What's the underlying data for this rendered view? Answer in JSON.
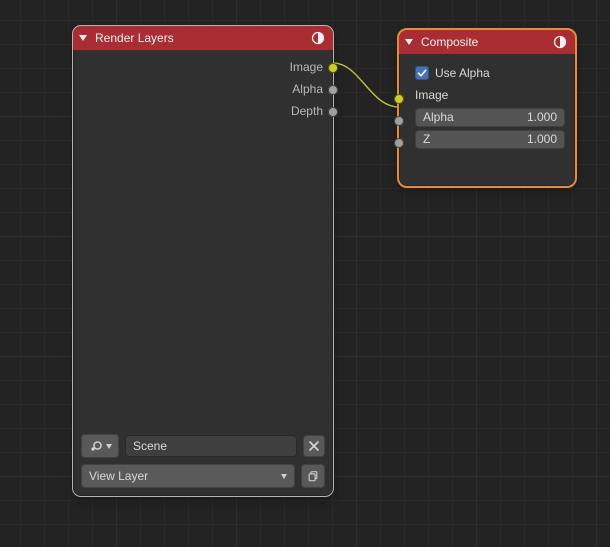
{
  "render_layers": {
    "title": "Render Layers",
    "outputs": {
      "image": "Image",
      "alpha": "Alpha",
      "depth": "Depth"
    },
    "scene_name": "Scene",
    "view_layer": "View Layer"
  },
  "composite": {
    "title": "Composite",
    "use_alpha_label": "Use Alpha",
    "use_alpha_checked": true,
    "inputs": {
      "image": "Image",
      "alpha": {
        "label": "Alpha",
        "value": "1.000"
      },
      "z": {
        "label": "Z",
        "value": "1.000"
      }
    }
  }
}
